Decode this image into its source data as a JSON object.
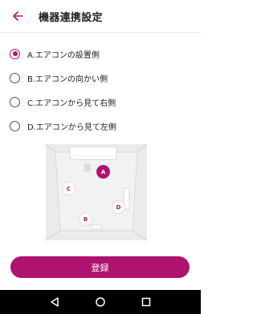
{
  "header": {
    "title": "機器連携設定",
    "back_icon": "arrow-left-icon"
  },
  "options": [
    {
      "label": "A.エアコンの設置側",
      "checked": true
    },
    {
      "label": "B.エアコンの向かい側",
      "checked": false
    },
    {
      "label": "C.エアコンから見て右側",
      "checked": false
    },
    {
      "label": "D.エアコンから見て左側",
      "checked": false
    }
  ],
  "room_diagram": {
    "markers": [
      {
        "letter": "A",
        "selected": true
      },
      {
        "letter": "B",
        "selected": false
      },
      {
        "letter": "C",
        "selected": false
      },
      {
        "letter": "D",
        "selected": false
      }
    ]
  },
  "submit": {
    "label": "登録"
  },
  "colors": {
    "accent": "#b0136e",
    "navbar": "#000000"
  },
  "navbar": {
    "icons": [
      "back-triangle-icon",
      "home-circle-icon",
      "recents-square-icon"
    ]
  }
}
